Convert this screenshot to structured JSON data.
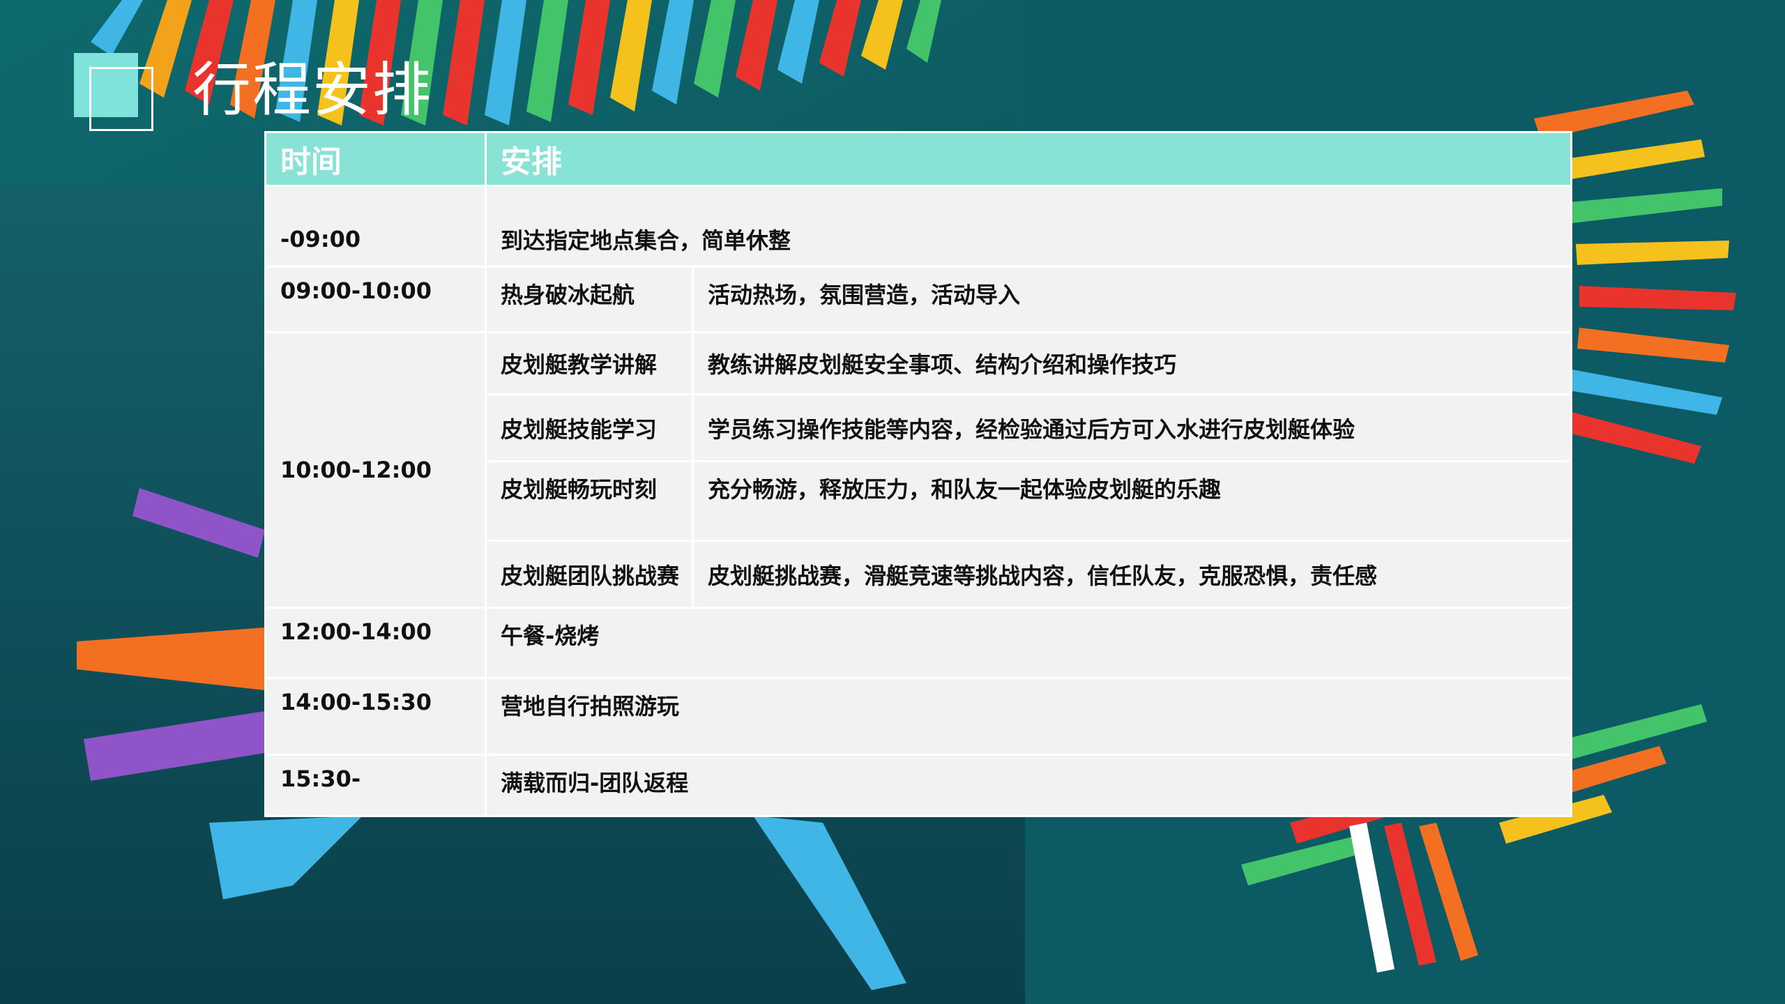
{
  "title": "行程安排",
  "table": {
    "headers": [
      "时间",
      "安排"
    ],
    "rows": [
      {
        "time": "-09:00",
        "activity": "到达指定地点集合，简单休整"
      },
      {
        "time": "09:00-10:00",
        "activity": "热身破冰起航",
        "detail": "活动热场，氛围营造，活动导入"
      },
      {
        "time": "10:00-12:00",
        "items": [
          {
            "activity": "皮划艇教学讲解",
            "detail": "教练讲解皮划艇安全事项、结构介绍和操作技巧"
          },
          {
            "activity": "皮划艇技能学习",
            "detail": "学员练习操作技能等内容，经检验通过后方可入水进行皮划艇体验"
          },
          {
            "activity": "皮划艇畅玩时刻",
            "detail": "充分畅游，释放压力，和队友一起体验皮划艇的乐趣"
          },
          {
            "activity": "皮划艇团队挑战赛",
            "detail": "皮划艇挑战赛，滑艇竞速等挑战内容，信任队友，克服恐惧，责任感"
          }
        ]
      },
      {
        "time": "12:00-14:00",
        "activity": "午餐-烧烤"
      },
      {
        "time": "14:00-15:30",
        "activity": "营地自行拍照游玩"
      },
      {
        "time": "15:30-",
        "activity": "满载而归-团队返程"
      }
    ]
  },
  "colors": {
    "header": "#87e3d5",
    "accent": "#7fe3db",
    "cell": "#f2f2f2",
    "water": "#0f5a62"
  }
}
